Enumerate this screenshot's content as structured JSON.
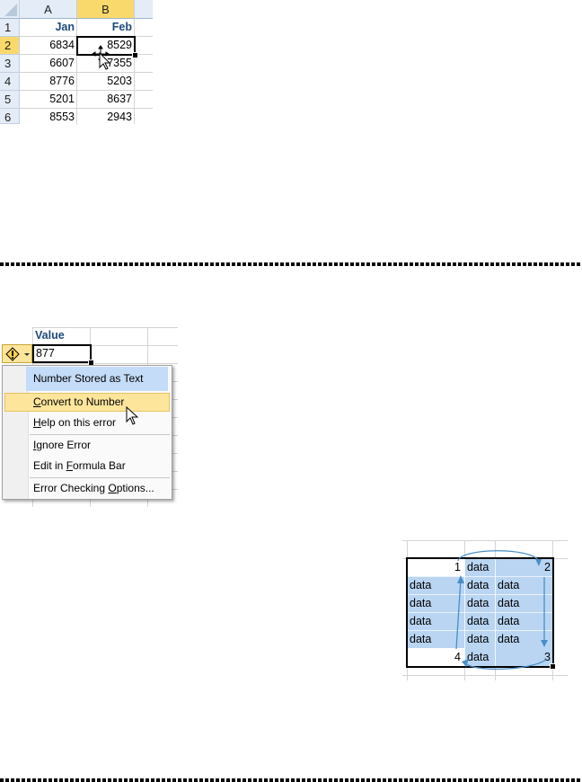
{
  "grid1": {
    "columns": [
      "A",
      "B"
    ],
    "rows": [
      "1",
      "2",
      "3",
      "4",
      "5",
      "6"
    ],
    "headers": [
      "Jan",
      "Feb"
    ],
    "data": [
      [
        "6834",
        "8529"
      ],
      [
        "6607",
        "7355"
      ],
      [
        "8776",
        "5203"
      ],
      [
        "5201",
        "8637"
      ],
      [
        "8553",
        "2943"
      ]
    ]
  },
  "grid2": {
    "header": "Value",
    "active_value": "877",
    "menu": {
      "title": "Number Stored as Text",
      "items": [
        {
          "pre": "",
          "key": "C",
          "post": "onvert to Number"
        },
        {
          "pre": "",
          "key": "H",
          "post": "elp on this error"
        },
        {
          "pre": "",
          "key": "I",
          "post": "gnore Error"
        },
        {
          "pre": "Edit in ",
          "key": "F",
          "post": "ormula Bar"
        },
        {
          "pre": "Error Checking ",
          "key": "O",
          "post": "ptions..."
        }
      ]
    }
  },
  "grid3": {
    "cells": {
      "r0": [
        "1",
        "data",
        "",
        "2"
      ],
      "r1": [
        "data",
        "",
        "data",
        "data"
      ],
      "r2": [
        "data",
        "",
        "data",
        "data"
      ],
      "r3": [
        "data",
        "",
        "data",
        "data"
      ],
      "r4": [
        "data",
        "",
        "data",
        "data"
      ],
      "r5": [
        "4",
        "data",
        "",
        "3"
      ]
    }
  },
  "colors": {
    "header_blue": "#1f497d",
    "selection_fill": "#b9d5f2",
    "arrow": "#4a8ec7",
    "highlight": "#fde59c"
  }
}
